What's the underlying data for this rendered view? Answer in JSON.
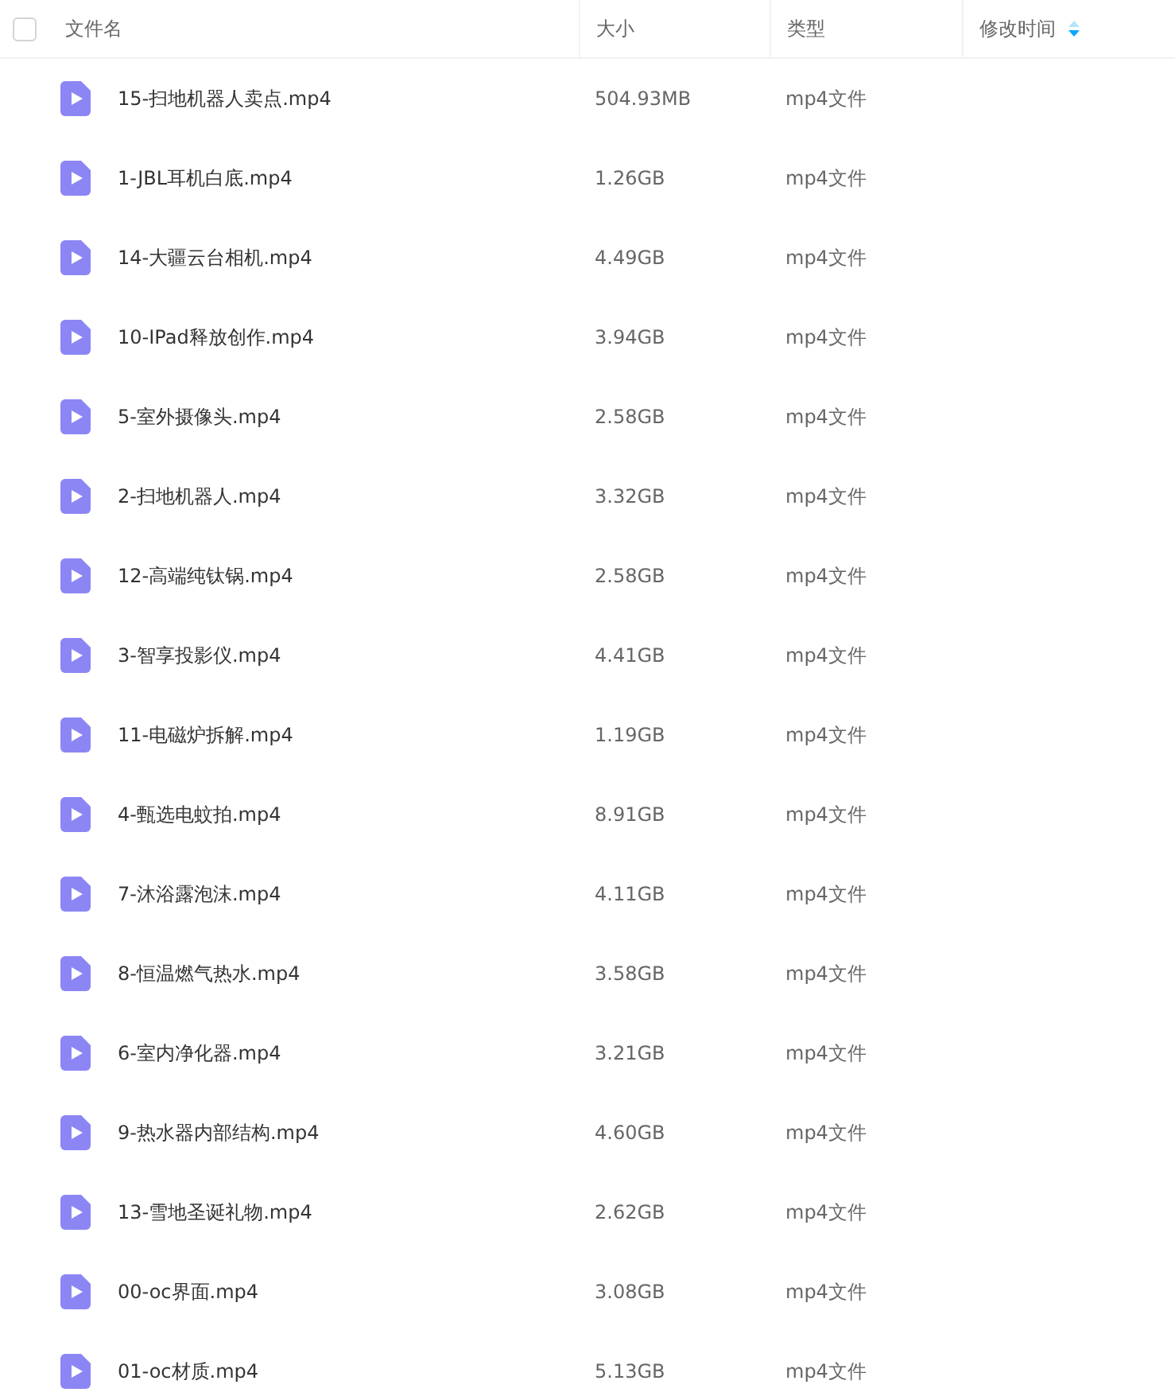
{
  "header": {
    "select_all": {
      "checked": false
    },
    "columns": [
      {
        "label": "文件名",
        "kind": "name"
      },
      {
        "label": "大小",
        "kind": "size"
      },
      {
        "label": "类型",
        "kind": "type"
      },
      {
        "label": "修改时间",
        "kind": "modified",
        "sorted": true
      }
    ]
  },
  "files": [
    {
      "name": "15-扫地机器人卖点.mp4",
      "size": "504.93MB",
      "type": "mp4文件"
    },
    {
      "name": "1-JBL耳机白底.mp4",
      "size": "1.26GB",
      "type": "mp4文件"
    },
    {
      "name": "14-大疆云台相机.mp4",
      "size": "4.49GB",
      "type": "mp4文件"
    },
    {
      "name": "10-IPad释放创作.mp4",
      "size": "3.94GB",
      "type": "mp4文件"
    },
    {
      "name": "5-室外摄像头.mp4",
      "size": "2.58GB",
      "type": "mp4文件"
    },
    {
      "name": "2-扫地机器人.mp4",
      "size": "3.32GB",
      "type": "mp4文件"
    },
    {
      "name": "12-高端纯钛锅.mp4",
      "size": "2.58GB",
      "type": "mp4文件"
    },
    {
      "name": "3-智享投影仪.mp4",
      "size": "4.41GB",
      "type": "mp4文件"
    },
    {
      "name": "11-电磁炉拆解.mp4",
      "size": "1.19GB",
      "type": "mp4文件"
    },
    {
      "name": "4-甄选电蚊拍.mp4",
      "size": "8.91GB",
      "type": "mp4文件"
    },
    {
      "name": "7-沐浴露泡沫.mp4",
      "size": "4.11GB",
      "type": "mp4文件"
    },
    {
      "name": "8-恒温燃气热水.mp4",
      "size": "3.58GB",
      "type": "mp4文件"
    },
    {
      "name": "6-室内净化器.mp4",
      "size": "3.21GB",
      "type": "mp4文件"
    },
    {
      "name": "9-热水器内部结构.mp4",
      "size": "4.60GB",
      "type": "mp4文件"
    },
    {
      "name": "13-雪地圣诞礼物.mp4",
      "size": "2.62GB",
      "type": "mp4文件"
    },
    {
      "name": "00-oc界面.mp4",
      "size": "3.08GB",
      "type": "mp4文件"
    },
    {
      "name": "01-oc材质.mp4",
      "size": "5.13GB",
      "type": "mp4文件"
    }
  ]
}
